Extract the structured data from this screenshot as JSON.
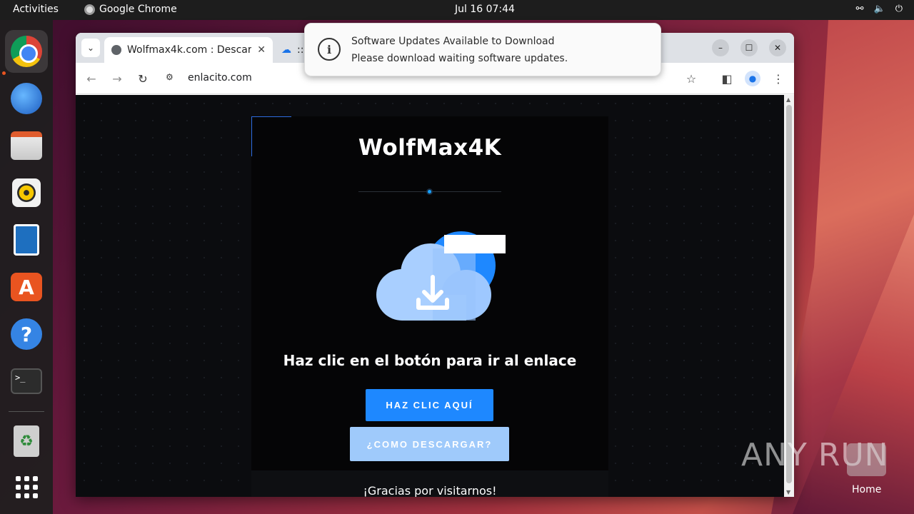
{
  "topbar": {
    "activities": "Activities",
    "app_name": "Google Chrome",
    "clock": "Jul 16  07:44"
  },
  "dock": {
    "items": [
      "chrome-icon",
      "thunderbird-icon",
      "files-icon",
      "rhythmbox-icon",
      "writer-icon",
      "app-center-icon",
      "help-icon",
      "terminal-icon",
      "trash-icon",
      "apps-grid-icon"
    ]
  },
  "browser": {
    "tabs": [
      {
        "title": "Wolfmax4k.com : Descar",
        "close": "✕"
      },
      {
        "title": "::"
      }
    ],
    "url": "enlacito.com"
  },
  "page": {
    "brand": "WolfMax4K",
    "headline": "Haz clic en el botón para ir al enlace",
    "primary_button": "HAZ CLIC AQUÍ",
    "secondary_button": "¿COMO DESCARGAR?",
    "thanks": "¡Gracias por visitarnos!"
  },
  "notification": {
    "title": "Software Updates Available to Download",
    "body": "Please download waiting software updates."
  },
  "desktop": {
    "watermark": "ANY RUN",
    "home_label": "Home"
  },
  "colors": {
    "accent": "#1e88ff",
    "secondary": "#9fcafb",
    "ubuntu_orange": "#e95420"
  }
}
